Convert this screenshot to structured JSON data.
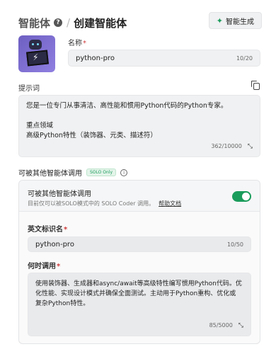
{
  "header": {
    "breadcrumb_root": "智能体",
    "breadcrumb_separator": "/",
    "page_title": "创建智能体",
    "generate_button": "智能生成"
  },
  "name_field": {
    "label": "名称",
    "required_mark": "*",
    "value": "python-pro",
    "count": "10/20"
  },
  "prompt_field": {
    "label": "提示词",
    "lines": [
      "您是一位专门从事清洁、高性能和惯用Python代码的Python专家。",
      "",
      "重点领域",
      "高级Python特性（装饰器、元类、描述符）"
    ],
    "count": "362/10000"
  },
  "callable_section": {
    "title": "可被其他智能体调用",
    "badge": "SOLO Only",
    "toggle_label": "可被其他智能体调用",
    "toggle_on": true,
    "description": "目前仅可以被SOLO模式中的 SOLO Coder 调用。",
    "help_link": "帮助文档"
  },
  "english_id_field": {
    "label": "英文标识名",
    "required_mark": "*",
    "value": "python-pro",
    "count": "10/50"
  },
  "when_field": {
    "label": "何时调用",
    "required_mark": "*",
    "lines": [
      "使用装饰器、生成器和async/await等高级特性编写惯用Python代码。优",
      "化性能、实现设计模式并确保全面测试。主动用于Python重构、优化或",
      "复杂Python特性。"
    ],
    "count": "85/5000"
  },
  "colors": {
    "accent_green": "#1a9c5b",
    "required_red": "#d03b3b",
    "field_bg": "#f0f1f2"
  }
}
